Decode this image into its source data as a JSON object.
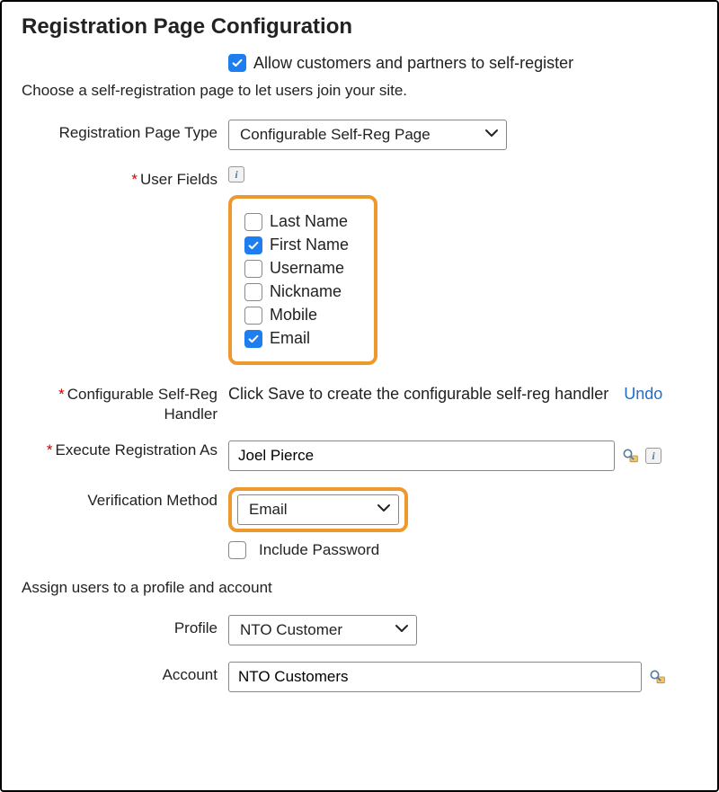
{
  "title": "Registration Page Configuration",
  "allow_self_register": {
    "label": "Allow customers and partners to self-register",
    "checked": true
  },
  "instructions": "Choose a self-registration page to let users join your site.",
  "registration_page_type": {
    "label": "Registration Page Type",
    "value": "Configurable Self-Reg Page"
  },
  "user_fields": {
    "label": "User Fields",
    "required": true,
    "items": [
      {
        "label": "Last Name",
        "checked": false
      },
      {
        "label": "First Name",
        "checked": true
      },
      {
        "label": "Username",
        "checked": false
      },
      {
        "label": "Nickname",
        "checked": false
      },
      {
        "label": "Mobile",
        "checked": false
      },
      {
        "label": "Email",
        "checked": true
      }
    ]
  },
  "handler": {
    "label": "Configurable Self-Reg Handler",
    "required": true,
    "text": "Click Save to create the configurable self-reg handler",
    "undo": "Undo"
  },
  "execute_as": {
    "label": "Execute Registration As",
    "required": true,
    "value": "Joel Pierce"
  },
  "verification_method": {
    "label": "Verification Method",
    "value": "Email"
  },
  "include_password": {
    "label": "Include Password",
    "checked": false
  },
  "assign_text": "Assign users to a profile and account",
  "profile": {
    "label": "Profile",
    "value": "NTO Customer"
  },
  "account": {
    "label": "Account",
    "value": "NTO Customers"
  }
}
